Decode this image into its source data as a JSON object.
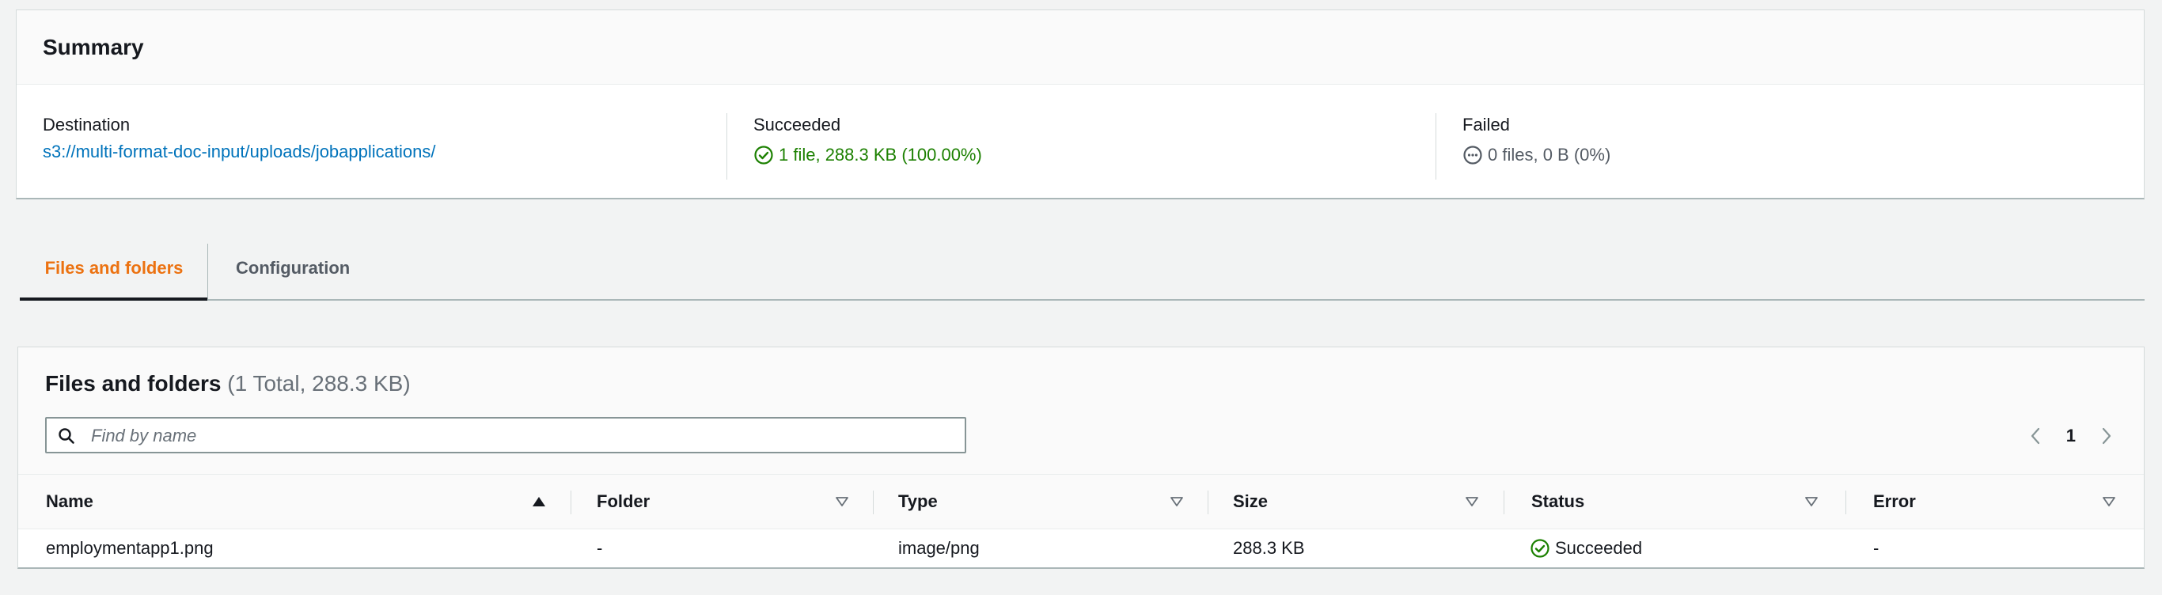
{
  "summary": {
    "title": "Summary",
    "destination_label": "Destination",
    "destination_value": "s3://multi-format-doc-input/uploads/jobapplications/",
    "succeeded_label": "Succeeded",
    "succeeded_value": "1 file, 288.3 KB (100.00%)",
    "failed_label": "Failed",
    "failed_value": "0 files, 0 B (0%)"
  },
  "tabs": [
    {
      "label": "Files and folders",
      "active": true
    },
    {
      "label": "Configuration",
      "active": false
    }
  ],
  "files": {
    "title": "Files and folders",
    "count": "(1 Total, 288.3 KB)",
    "search_placeholder": "Find by name",
    "page": "1",
    "columns": [
      "Name",
      "Folder",
      "Type",
      "Size",
      "Status",
      "Error"
    ],
    "rows": [
      {
        "name": "employmentapp1.png",
        "folder": "-",
        "type": "image/png",
        "size": "288.3 KB",
        "status": "Succeeded",
        "error": "-"
      }
    ]
  },
  "colors": {
    "link": "#0073bb",
    "success": "#1d8102",
    "accent": "#ec7211"
  },
  "icons": [
    "success-check-icon",
    "failed-ellipsis-icon",
    "search-icon",
    "chevron-left-icon",
    "chevron-right-icon",
    "sort-ascending-icon",
    "sort-descending-icon"
  ]
}
